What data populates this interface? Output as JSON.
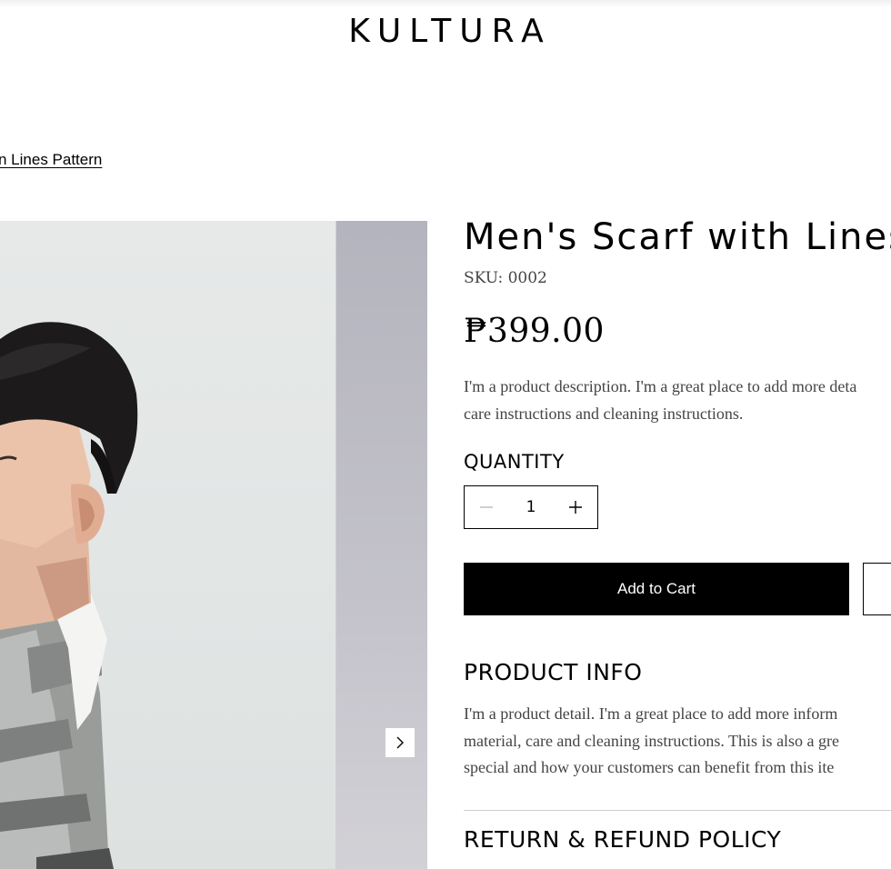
{
  "header": {
    "logo": "KULTURA"
  },
  "breadcrumb": {
    "current": "n Lines Pattern"
  },
  "gallery": {
    "next_icon": "chevron-right-icon"
  },
  "product": {
    "title": "Men's Scarf with Lines",
    "sku": "SKU: 0002",
    "price": "₱399.00",
    "description_lines": [
      "I'm a product description. I'm a great place to add more deta",
      "care instructions and cleaning instructions."
    ],
    "quantity_label": "QUANTITY",
    "quantity_value": "1",
    "add_to_cart_label": "Add to Cart"
  },
  "sections": {
    "info_title": "PRODUCT INFO",
    "info_lines": [
      "I'm a product detail. I'm a great place to add more inform",
      "material, care and cleaning instructions. This is also a gre",
      "special and how your customers can benefit from this ite"
    ],
    "refund_title": "RETURN & REFUND POLICY"
  },
  "colors": {
    "primary": "#000000",
    "background": "#ffffff",
    "body_text": "#444444"
  }
}
